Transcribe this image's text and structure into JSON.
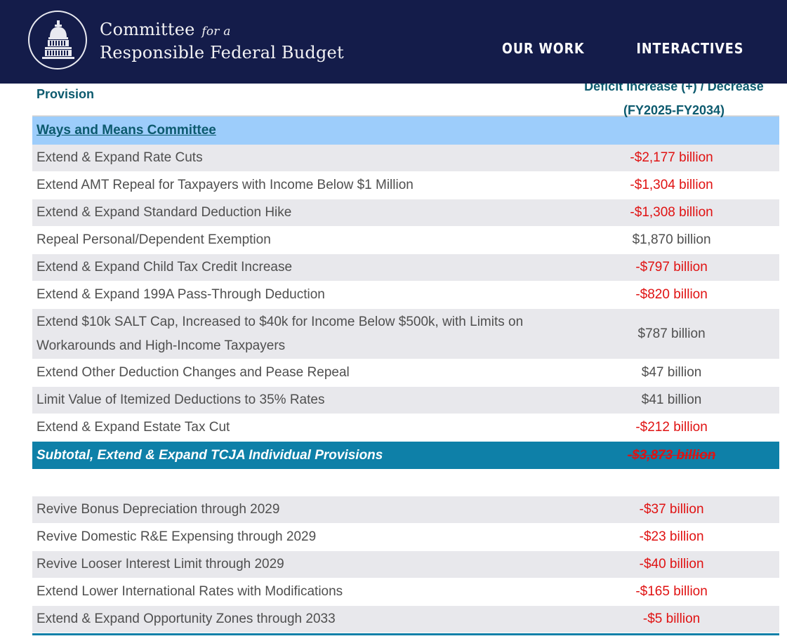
{
  "header": {
    "org_line1": "Committee",
    "org_fora": "for a",
    "org_line2": "Responsible Federal Budget",
    "nav": [
      "OUR WORK",
      "INTERACTIVES"
    ]
  },
  "table": {
    "col_provision": "Provision",
    "col_impact_line1": "Deficit Increase (+) / Decrease",
    "col_impact_line2": "(FY2025-FY2034)",
    "section": "Ways and Means Committee",
    "rows": [
      {
        "provision": "Extend & Expand Rate Cuts",
        "value": "-$2,177 billion",
        "negative": true
      },
      {
        "provision": "Extend AMT Repeal for Taxpayers with Income Below $1 Million",
        "value": "-$1,304 billion",
        "negative": true
      },
      {
        "provision": "Extend & Expand Standard Deduction Hike",
        "value": "-$1,308 billion",
        "negative": true
      },
      {
        "provision": "Repeal Personal/Dependent Exemption",
        "value": "$1,870 billion",
        "negative": false
      },
      {
        "provision": "Extend & Expand Child Tax Credit Increase",
        "value": "-$797 billion",
        "negative": true
      },
      {
        "provision": "Extend & Expand 199A Pass-Through Deduction",
        "value": "-$820 billion",
        "negative": true
      },
      {
        "provision": "Extend $10k SALT Cap, Increased to $40k for Income Below $500k, with Limits on Workarounds and High-Income Taxpayers",
        "value": "$787 billion",
        "negative": false
      },
      {
        "provision": "Extend Other Deduction Changes and Pease Repeal",
        "value": "$47 billion",
        "negative": false
      },
      {
        "provision": "Limit Value of Itemized Deductions to 35% Rates",
        "value": "$41 billion",
        "negative": false
      },
      {
        "provision": "Extend & Expand Estate Tax Cut",
        "value": "-$212 billion",
        "negative": true
      }
    ],
    "subtotal": {
      "provision": "Subtotal, Extend & Expand TCJA Individual Provisions",
      "value": "-$3,873 billion"
    },
    "rows2": [
      {
        "provision": "Revive Bonus Depreciation through 2029",
        "value": "-$37 billion",
        "negative": true
      },
      {
        "provision": "Revive Domestic R&E Expensing through 2029",
        "value": "-$23 billion",
        "negative": true
      },
      {
        "provision": "Revive Looser Interest Limit through 2029",
        "value": "-$40 billion",
        "negative": true
      },
      {
        "provision": "Extend Lower International Rates with Modifications",
        "value": "-$165 billion",
        "negative": true
      },
      {
        "provision": "Extend & Expand Opportunity Zones through 2033",
        "value": "-$5 billion",
        "negative": true
      }
    ]
  },
  "colors": {
    "header_bg": "#141c4a",
    "section_bg": "#9dcdfb",
    "subtotal_bg": "#0e80a8",
    "negative_text": "#e01212",
    "heading_text": "#0c5a6e"
  }
}
